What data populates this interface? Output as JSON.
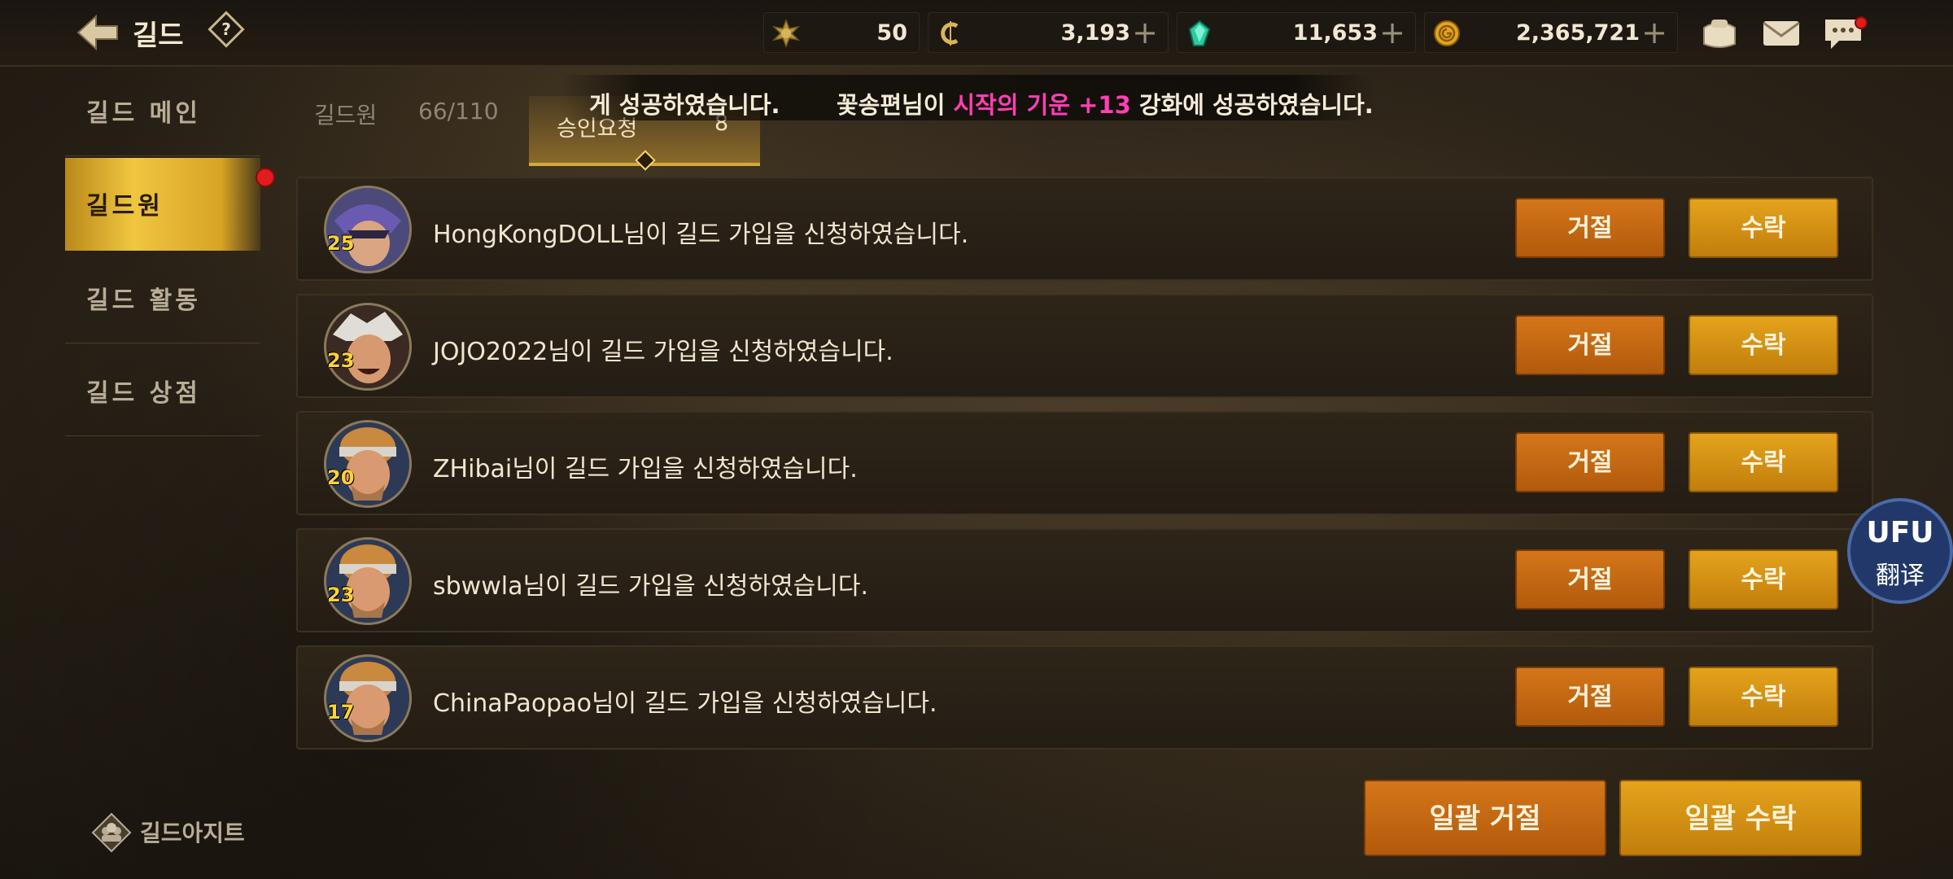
{
  "header": {
    "title": "길드",
    "help_label": "?",
    "currencies": [
      {
        "icon": "sun-badge-icon",
        "value": "50",
        "has_plus": false
      },
      {
        "icon": "c-coin-icon",
        "value": "3,193",
        "has_plus": true
      },
      {
        "icon": "green-gem-icon",
        "value": "11,653",
        "has_plus": true
      },
      {
        "icon": "gold-coin-icon",
        "value": "2,365,721",
        "has_plus": true
      }
    ],
    "plus_label": "+"
  },
  "sidebar": {
    "items": [
      {
        "label": "길드 메인"
      },
      {
        "label": "길드원"
      },
      {
        "label": "길드 활동"
      },
      {
        "label": "길드 상점"
      }
    ],
    "hideout_label": "길드아지트"
  },
  "tabs": {
    "members_label": "길드원",
    "members_count": "66/110",
    "requests_label": "승인요청",
    "requests_count": "8"
  },
  "ticker": {
    "part1": "게 성공하였습니다.",
    "part2_prefix": "꽃송편님이 ",
    "part2_item": "시작의 기운 +13",
    "part2_suffix": " 강화에 성공하였습니다."
  },
  "requests": [
    {
      "name": "HongKongDOLL",
      "level": "25",
      "message": "HongKongDOLL님이 길드 가입을 신청하였습니다."
    },
    {
      "name": "JOJO2022",
      "level": "23",
      "message": "JOJO2022님이 길드 가입을 신청하였습니다."
    },
    {
      "name": "ZHibai",
      "level": "20",
      "message": "ZHibai님이 길드 가입을 신청하였습니다."
    },
    {
      "name": "sbwwla",
      "level": "23",
      "message": "sbwwla님이 길드 가입을 신청하였습니다."
    },
    {
      "name": "ChinaPaopao",
      "level": "17",
      "message": "ChinaPaopao님이 길드 가입을 신청하였습니다."
    }
  ],
  "buttons": {
    "reject": "거절",
    "accept": "수락",
    "bulk_reject": "일괄 거절",
    "bulk_accept": "일괄 수락"
  },
  "translate_widget": {
    "logo": "UFU",
    "label": "翻译"
  },
  "colors": {
    "accent_gold": "#d4a93a",
    "reject_orange": "#c4680f",
    "accept_gold": "#d8950f",
    "highlight_pink": "#ff3fb4",
    "notification_red": "#e01c1c"
  }
}
